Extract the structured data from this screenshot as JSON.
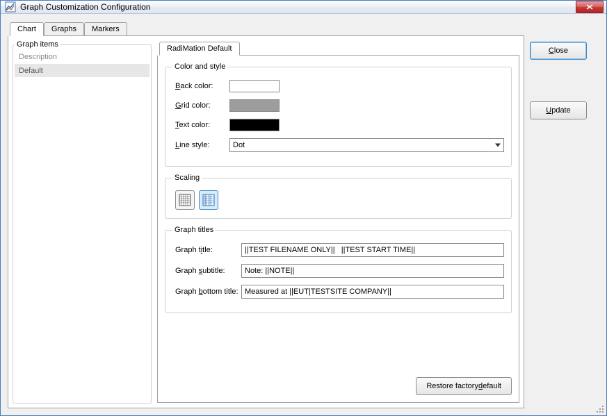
{
  "window": {
    "title": "Graph Customization Configuration"
  },
  "tabs": {
    "items": [
      {
        "label": "Chart",
        "active": true
      },
      {
        "label": "Graphs",
        "active": false
      },
      {
        "label": "Markers",
        "active": false
      }
    ]
  },
  "graph_items": {
    "legend": "Graph items",
    "header": "Description",
    "items": [
      {
        "label": "Default"
      }
    ]
  },
  "inner_tabs": {
    "items": [
      {
        "label": "RadiMation Default",
        "active": true
      }
    ]
  },
  "color_style": {
    "legend": "Color and style",
    "back_label": "Back color:",
    "back_color": "#ffffff",
    "grid_label": "Grid color:",
    "grid_color": "#9d9d9d",
    "text_label": "Text color:",
    "text_color": "#000000",
    "linestyle_label": "Line style:",
    "linestyle_value": "Dot"
  },
  "scaling": {
    "legend": "Scaling"
  },
  "titles": {
    "legend": "Graph titles",
    "title_label": "Graph title:",
    "title_value": "||TEST FILENAME ONLY||   ||TEST START TIME||",
    "subtitle_label": "Graph subtitle:",
    "subtitle_value": "Note: ||NOTE||",
    "bottom_label": "Graph bottom title:",
    "bottom_value": "Measured at ||EUT|TESTSITE COMPANY||"
  },
  "buttons": {
    "restore": "Restore factory default",
    "close": "Close",
    "update": "Update"
  }
}
